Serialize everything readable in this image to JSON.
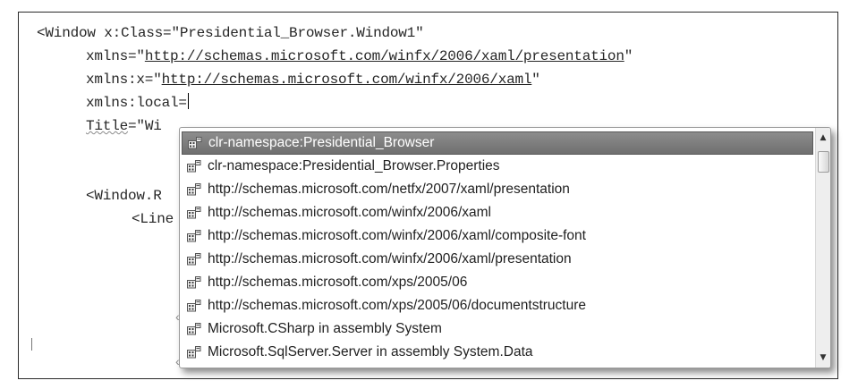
{
  "editor": {
    "lines": [
      {
        "attr": "<Window x:Class=",
        "value": "\"Presidential_Browser.Window1\""
      },
      {
        "attr": "xmlns=",
        "q1": "\"",
        "link": "http://schemas.microsoft.com/winfx/2006/xaml/presentation",
        "q2": "\""
      },
      {
        "attr": "xmlns:x=",
        "q1": "\"",
        "link": "http://schemas.microsoft.com/winfx/2006/xaml",
        "q2": "\""
      },
      {
        "attr": "xmlns:local="
      },
      {
        "attr": "Title",
        "rest": "=\"Wi"
      },
      {
        "text": "<Window.R"
      },
      {
        "text": "<Line"
      }
    ]
  },
  "completion": {
    "items": [
      "clr-namespace:Presidential_Browser",
      "clr-namespace:Presidential_Browser.Properties",
      "http://schemas.microsoft.com/netfx/2007/xaml/presentation",
      "http://schemas.microsoft.com/winfx/2006/xaml",
      "http://schemas.microsoft.com/winfx/2006/xaml/composite-font",
      "http://schemas.microsoft.com/winfx/2006/xaml/presentation",
      "http://schemas.microsoft.com/xps/2005/06",
      "http://schemas.microsoft.com/xps/2005/06/documentstructure",
      "Microsoft.CSharp in assembly System",
      "Microsoft.SqlServer.Server in assembly System.Data"
    ],
    "selected_index": 0,
    "item_icon": "namespace-icon",
    "scroll_up_glyph": "▲",
    "scroll_down_glyph": "▼"
  },
  "colors": {
    "selection": "#7a7a7a",
    "text": "#262626"
  }
}
